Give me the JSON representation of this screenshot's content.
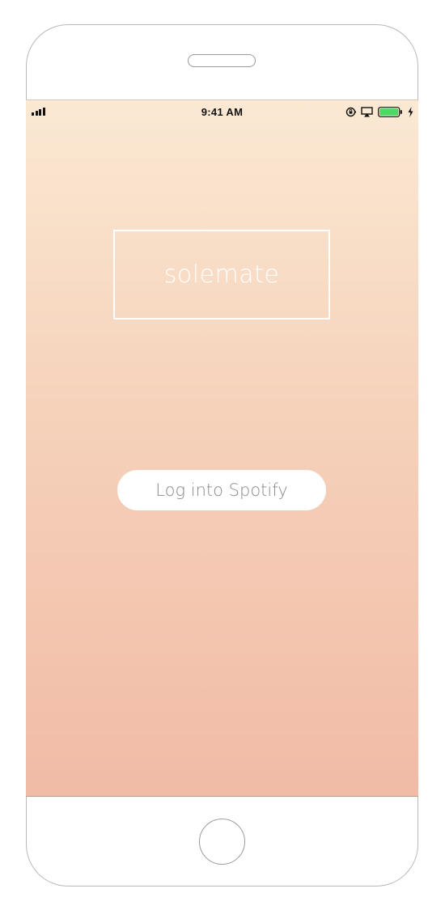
{
  "status_bar": {
    "time": "9:41 AM",
    "icons": [
      "signal-icon",
      "rotation-lock-icon",
      "airplay-icon",
      "battery-icon",
      "charging-bolt-icon"
    ]
  },
  "app": {
    "logo_text": "solemate",
    "login_button_label": "Log into Spotify"
  },
  "colors": {
    "gradient_top": "#fbe9d3",
    "gradient_bottom": "#f1bba6",
    "battery_fill": "#4cd964",
    "button_text": "#8a8a8a"
  }
}
